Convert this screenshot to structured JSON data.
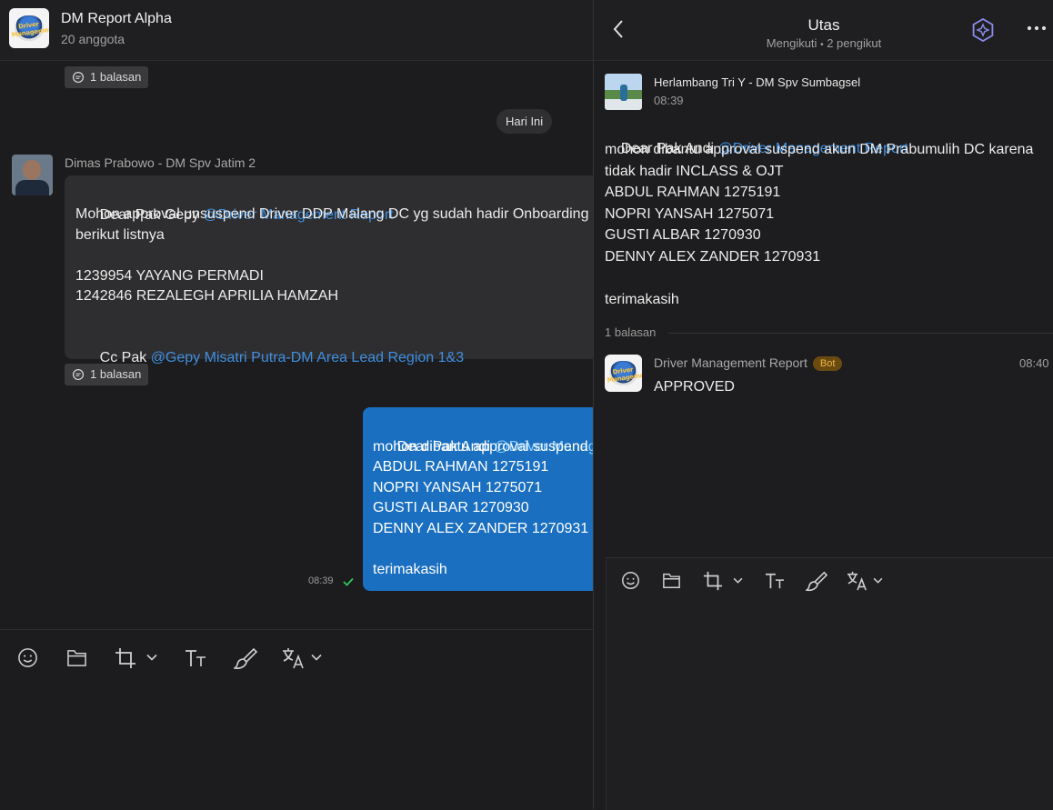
{
  "chat": {
    "title": "DM Report Alpha",
    "members": "20 anggota"
  },
  "reply_chip_1": "1 balasan",
  "date_divider": "Hari Ini",
  "message_1": {
    "sender": "Dimas Prabowo - DM Spv Jatim 2",
    "greeting": "Dear Pak Gepy ",
    "mention": "@Driver Management Report",
    "line2": "Mohon approval unsuspend Driver DDP Malang DC yg sudah hadir Onboarding a",
    "line3": "berikut listnya",
    "line5": "1239954 YAYANG PERMADI",
    "line6": "1242846 REZALEGH APRILIA HAMZAH",
    "cc": "Cc Pak ",
    "cc_mention": "@Gepy Misatri Putra-DM Area Lead Region 1&3",
    "reply_chip": "1 balasan"
  },
  "message_2": {
    "greeting": "Dear Pak Andi ",
    "mention": "@Driver Manageme",
    "line2": "mohon dibantu approval suspend a",
    "line3": "ABDUL RAHMAN 1275191",
    "line4": "NOPRI YANSAH 1275071",
    "line5": "GUSTI ALBAR 1270930",
    "line6": "DENNY ALEX ZANDER 1270931",
    "line8": "terimakasih",
    "time": "08:39"
  },
  "toolbar": {
    "icons": [
      "emoji-icon",
      "folder-icon",
      "crop-icon",
      "chevron-down-icon",
      "text-format-icon",
      "brush-icon",
      "translate-icon",
      "chevron-down-icon"
    ]
  },
  "thread": {
    "title": "Utas",
    "following": "Mengikuti",
    "separator": "•",
    "followers": "2 pengikut",
    "root": {
      "sender": "Herlambang Tri Y - DM Spv Sumbagsel",
      "time": "08:39",
      "greeting": "Dear Pak Andi ",
      "mention": "@Driver Management Report",
      "line2": "mohon dibantu approval suspend akun DM Prabumulih DC karena",
      "line3": "tidak hadir INCLASS & OJT",
      "line4": "ABDUL RAHMAN 1275191",
      "line5": "NOPRI YANSAH 1275071",
      "line6": "GUSTI ALBAR 1270930",
      "line7": "DENNY ALEX ZANDER 1270931",
      "line9": "terimakasih"
    },
    "reply_count": "1 balasan",
    "reply": {
      "sender": "Driver Management Report",
      "badge": "Bot",
      "time": "08:40",
      "text": "APPROVED"
    }
  },
  "logo_text": "Driver Management",
  "colors": {
    "background": "#1c1c1e",
    "mention": "#3f8fe0",
    "own_bubble": "#1a6fc0",
    "read_check": "#34c759",
    "bot_badge": "#6b4a10"
  }
}
